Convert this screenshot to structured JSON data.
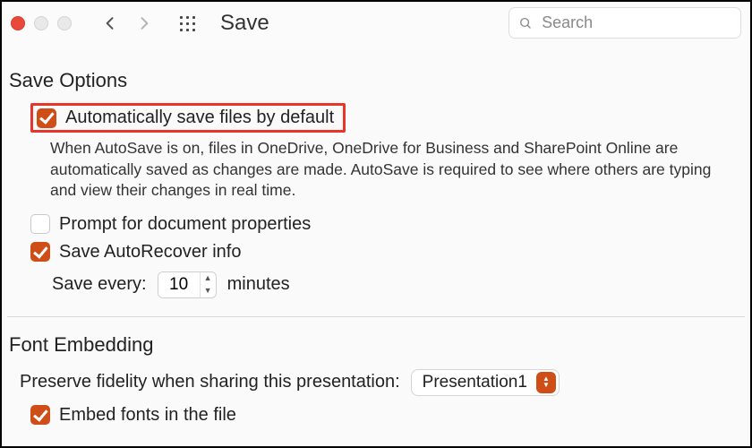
{
  "toolbar": {
    "title": "Save",
    "search_placeholder": "Search"
  },
  "save_options": {
    "heading": "Save Options",
    "autosave": {
      "checked": true,
      "label": "Automatically save files by default",
      "help": "When AutoSave is on, files in OneDrive, OneDrive for Business and SharePoint Online are automatically saved as changes are made. AutoSave is required to see where others are typing and view their changes in real time."
    },
    "prompt_props": {
      "checked": false,
      "label": "Prompt for document properties"
    },
    "autorecover": {
      "checked": true,
      "label": "Save AutoRecover info"
    },
    "interval": {
      "prefix": "Save every:",
      "value": "10",
      "suffix": "minutes"
    }
  },
  "font_embedding": {
    "heading": "Font Embedding",
    "preserve_label": "Preserve fidelity when sharing this presentation:",
    "presentation_selected": "Presentation1",
    "embed": {
      "checked": true,
      "label": "Embed fonts in the file"
    }
  }
}
